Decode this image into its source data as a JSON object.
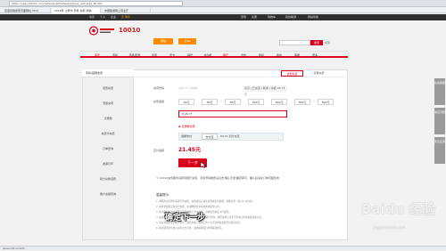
{
  "browser": {
    "url": "https://upay.10010.com/npfweb/npfcellweb/phone_recharge_fill.htm",
    "tabs": [
      "百度经验搜索页面网址.html",
      "2016年 上网卡 手机 充值 通信",
      "中国联通网上营业厅"
    ]
  },
  "topnav": {
    "items": [
      "北京",
      "个人",
      "企业",
      "沃·尊享",
      "登录",
      "注册",
      "购物车",
      "我的联通",
      "网站导航"
    ]
  },
  "header": {
    "brand_number": "10010",
    "sub_button_1": "网站",
    "sub_button_2": "沃4G",
    "search_button": "搜索",
    "right_link": "充值"
  },
  "mainnav": {
    "items": [
      "首页",
      "手机",
      "手机/配件",
      "宽带",
      "号卡",
      "靓号",
      "合约机",
      "网厅",
      "合作",
      "装机",
      "我的",
      "客服",
      "更多"
    ]
  },
  "sidebar": {
    "title": "手机/固网充值",
    "items": [
      "话费充值",
      "流量充值",
      "沃惠缴",
      "充值卡充值",
      "订单查询",
      "发票打印",
      "积分兑换话费",
      "账户余额查询"
    ]
  },
  "tabs": {
    "a": "话费充值",
    "b": "流量充值"
  },
  "form": {
    "phone_label": "充值号码",
    "phone_value": "186 **** 8888",
    "phone_hint": "北京 | 已充值 | 联通 | 余额 26.77元",
    "amount_label": "充值金额",
    "amounts": [
      "20元",
      "30元",
      "50元",
      "100元",
      "200元",
      "300元",
      "500元"
    ],
    "custom_amount": "¥ 26.77",
    "discount": "优惠券优惠",
    "pay_label": "选择支付",
    "pay_option": "支付宝",
    "pay_extra": "¥0.02  积分充值",
    "total_label": "应付金额",
    "total_value": "21.45元",
    "pay_button": "下一步"
  },
  "notice": "① 10010充值服务请转到网厅充值，手机号码缴费请点击'确认无误'确定即可，确认后请在订单页面查询",
  "notes": {
    "title": "温馨提示：",
    "lines": [
      "1. 本服务支持所有联通号码充值，充值成功后请注意查看短信提醒，到账时间一般为1-10分钟。",
      "2. 充值金额按实际支付到账，如遇网络异常请勿重复提交订单。",
      "3. 使用银行卡支付请确认已开通网上支付功能，具体请咨询发卡行客服。",
      "4. 如充值后话费未到账，请拨打10010客服热线进行咨询，或登录网上营业厅查询订单状态及充值记录。",
      "5. 请妥善保管您的账户信息，谨防诈骗，联通工作人员不会向您索要密码及验证码。",
      "6. 本页面所示优惠以实际支付为准，最终解释权归中国联通所有。"
    ]
  },
  "subtitle": "确定下一步",
  "watermark": {
    "main": "Baidu 经验",
    "sub": "jingyan.baidu.com"
  },
  "float_buttons": [
    "在线客服",
    "常见问题",
    "意见反馈"
  ],
  "statusbar": "javascript:void(0);"
}
